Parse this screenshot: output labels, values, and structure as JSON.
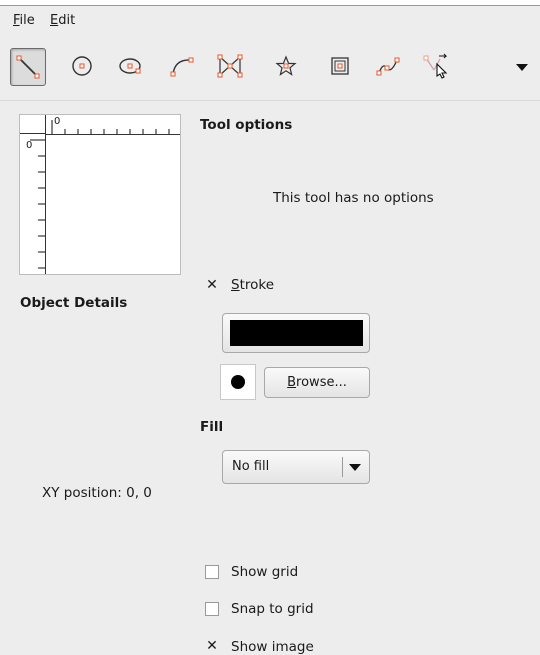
{
  "menu": {
    "file": "File",
    "edit": "Edit"
  },
  "toolbar": {
    "tools": [
      {
        "name": "line-tool-icon"
      },
      {
        "name": "circle-tool-icon"
      },
      {
        "name": "ellipse-tool-icon"
      },
      {
        "name": "arc-tool-icon"
      },
      {
        "name": "polygon-tool-icon"
      },
      {
        "name": "star-tool-icon"
      },
      {
        "name": "rectangle-tool-icon"
      },
      {
        "name": "curve-tool-icon"
      },
      {
        "name": "edit-points-tool-icon"
      }
    ],
    "accent_color": "#e8552b"
  },
  "preview": {
    "h_ruler_zero": "0",
    "v_ruler_zero": "0"
  },
  "tool_options": {
    "title": "Tool options",
    "message": "This tool has no options"
  },
  "object_details": {
    "title": "Object Details",
    "xy_label": "XY position:",
    "xy_value": "0, 0"
  },
  "stroke": {
    "label_mnemonic": "S",
    "label_rest": "troke",
    "checked": true,
    "color": "#000000",
    "browse_mnemonic": "B",
    "browse_rest": "rowse..."
  },
  "fill": {
    "title": "Fill",
    "selected": "No fill"
  },
  "options": {
    "show_grid": "Show grid",
    "snap_to_grid": "Snap to grid",
    "show_image": "Show image"
  }
}
